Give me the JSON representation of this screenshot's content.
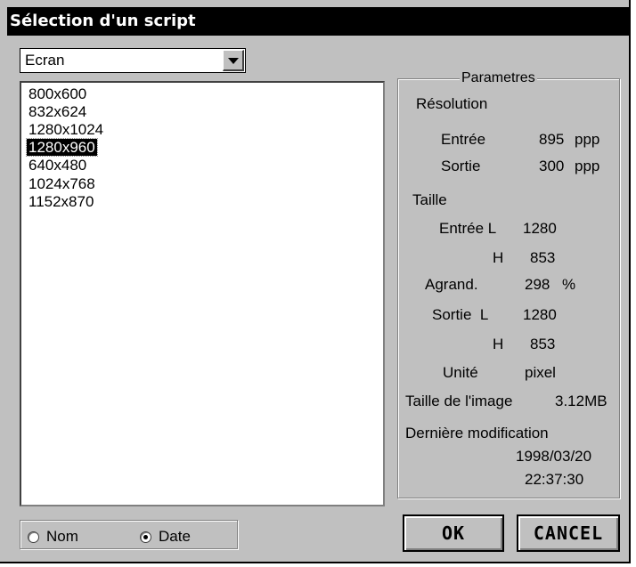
{
  "window": {
    "title": "Sélection d'un script"
  },
  "combo": {
    "value": "Ecran"
  },
  "list": {
    "items": [
      "800x600",
      "832x624",
      "1280x1024",
      "1280x960",
      "640x480",
      "1024x768",
      "1152x870"
    ],
    "selected": "1280x960"
  },
  "sort": {
    "nom_label": "Nom",
    "date_label": "Date",
    "selected": "Date"
  },
  "params": {
    "legend": "Parametres",
    "resolution_label": "Résolution",
    "entree_label": "Entrée",
    "entree_value": "895",
    "entree_unit": "ppp",
    "sortie_label": "Sortie",
    "sortie_value": "300",
    "sortie_unit": "ppp",
    "taille_label": "Taille",
    "entree_l_label": "Entrée L",
    "entree_l_value": "1280",
    "entree_h_label": "H",
    "entree_h_value": "853",
    "agrand_label": "Agrand.",
    "agrand_value": "298",
    "agrand_unit": "%",
    "sortie_l_label": "Sortie  L",
    "sortie_l_value": "1280",
    "sortie_h_label": "H",
    "sortie_h_value": "853",
    "unite_label": "Unité",
    "unite_value": "pixel",
    "taille_image_label": "Taille de l'image",
    "taille_image_value": "3.12MB",
    "derniere_label": "Dernière modification",
    "date_value": "1998/03/20",
    "time_value": "22:37:30"
  },
  "buttons": {
    "ok": "OK",
    "cancel": "CANCEL"
  }
}
